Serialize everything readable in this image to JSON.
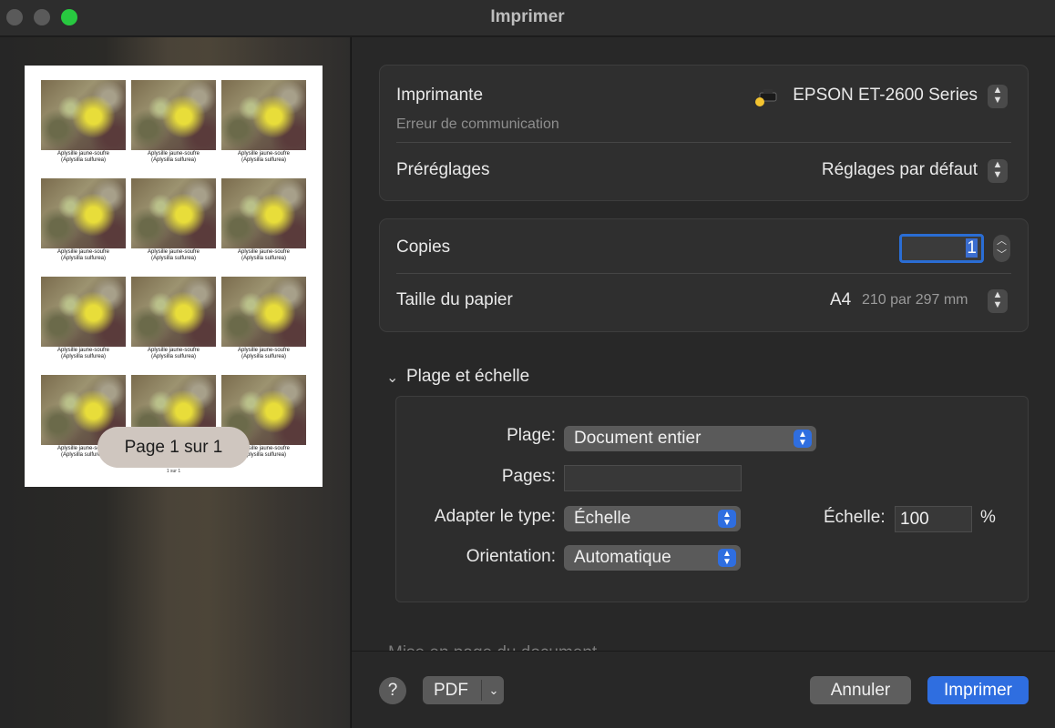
{
  "window": {
    "title": "Imprimer"
  },
  "preview": {
    "tiles": [
      {
        "line1": "Aplysille jaune-soufre",
        "line2": "(Aplysilla sulfurea)"
      },
      {
        "line1": "Aplysille jaune-soufre",
        "line2": "(Aplysilla sulfurea)"
      },
      {
        "line1": "Aplysille jaune-soufre",
        "line2": "(Aplysilla sulfurea)"
      },
      {
        "line1": "Aplysille jaune-soufre",
        "line2": "(Aplysilla sulfurea)"
      },
      {
        "line1": "Aplysille jaune-soufre",
        "line2": "(Aplysilla sulfurea)"
      },
      {
        "line1": "Aplysille jaune-soufre",
        "line2": "(Aplysilla sulfurea)"
      },
      {
        "line1": "Aplysille jaune-soufre",
        "line2": "(Aplysilla sulfurea)"
      },
      {
        "line1": "Aplysille jaune-soufre",
        "line2": "(Aplysilla sulfurea)"
      },
      {
        "line1": "Aplysille jaune-soufre",
        "line2": "(Aplysilla sulfurea)"
      },
      {
        "line1": "Aplysille jaune-soufre",
        "line2": "(Aplysilla sulfurea)"
      },
      {
        "line1": "Aplysille jaune-soufre",
        "line2": "(Aplysilla sulfurea)"
      },
      {
        "line1": "Aplysille jaune-soufre",
        "line2": "(Aplysilla sulfurea)"
      }
    ],
    "page_footer": "1 sur 1",
    "page_indicator": "Page 1 sur 1"
  },
  "printer": {
    "label": "Imprimante",
    "name": "EPSON ET-2600 Series",
    "status": "Erreur de communication",
    "status_icon": "printer-warning-icon"
  },
  "presets": {
    "label": "Préréglages",
    "value": "Réglages par défaut"
  },
  "copies": {
    "label": "Copies",
    "value": "1"
  },
  "paper": {
    "label": "Taille du papier",
    "size": "A4",
    "dimensions": "210 par 297 mm"
  },
  "range_scale": {
    "heading": "Plage et échelle",
    "range_label": "Plage:",
    "range_value": "Document entier",
    "pages_label": "Pages:",
    "pages_value": "",
    "fit_label": "Adapter le type:",
    "fit_value": "Échelle",
    "scale_label": "Échelle:",
    "scale_value": "100",
    "scale_unit": "%",
    "orientation_label": "Orientation:",
    "orientation_value": "Automatique"
  },
  "collapsed_section": {
    "heading": "Mise en page du document"
  },
  "footer": {
    "help": "?",
    "pdf_label": "PDF",
    "cancel_label": "Annuler",
    "print_label": "Imprimer"
  },
  "colors": {
    "accent": "#2f6ee0",
    "close_light": "#5a5a5a",
    "zoom_light": "#28c840"
  }
}
